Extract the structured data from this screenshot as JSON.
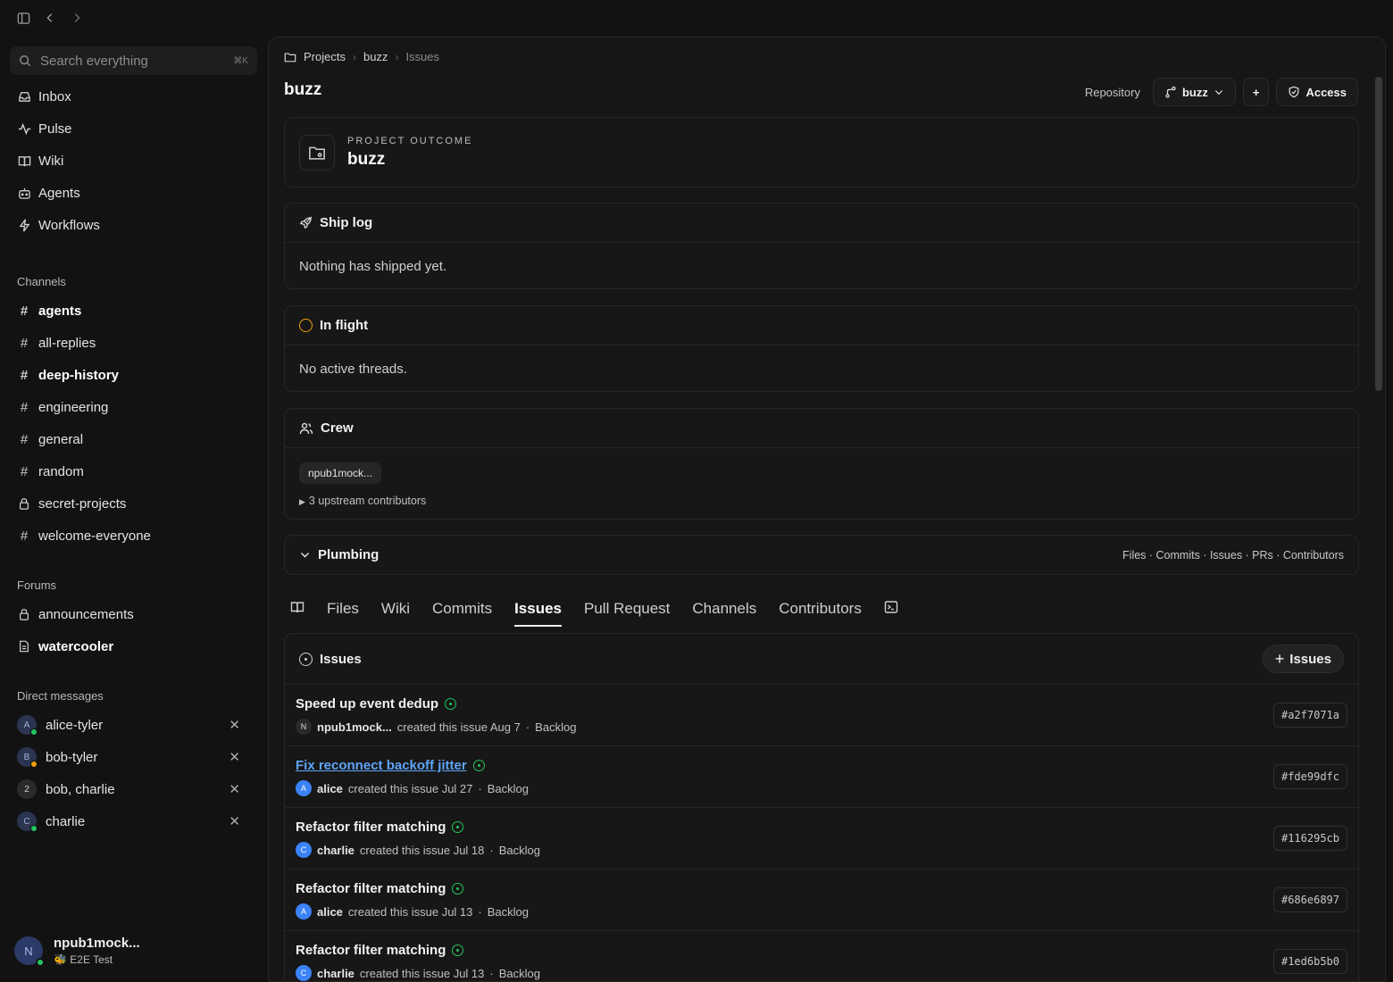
{
  "sidebar": {
    "search_placeholder": "Search everything",
    "search_shortcut": "⌘K",
    "nav": [
      {
        "label": "Inbox",
        "icon": "inbox-icon"
      },
      {
        "label": "Pulse",
        "icon": "pulse-icon"
      },
      {
        "label": "Wiki",
        "icon": "book-icon"
      },
      {
        "label": "Agents",
        "icon": "bot-icon"
      },
      {
        "label": "Workflows",
        "icon": "bolt-icon"
      }
    ],
    "channels_label": "Channels",
    "channels": [
      "agents",
      "all-replies",
      "deep-history",
      "engineering",
      "general",
      "random",
      "secret-projects",
      "welcome-everyone"
    ],
    "forums_label": "Forums",
    "forums": [
      "announcements",
      "watercooler"
    ],
    "dm_label": "Direct messages",
    "dms": [
      {
        "name": "alice-tyler",
        "initial": "A",
        "status_color": "#22c55e"
      },
      {
        "name": "bob-tyler",
        "initial": "B",
        "status_color": "#f59e0b"
      },
      {
        "name": "bob, charlie",
        "initial": "2",
        "status_color": ""
      },
      {
        "name": "charlie",
        "initial": "C",
        "status_color": "#22c55e"
      }
    ],
    "user": {
      "initial": "N",
      "name": "npub1mock...",
      "subtitle": "E2E Test"
    }
  },
  "breadcrumb": [
    "Projects",
    "buzz",
    "Issues"
  ],
  "page_title": "buzz",
  "header": {
    "repository_label": "Repository",
    "branch": "buzz",
    "add": "+",
    "access": "Access"
  },
  "outcome": {
    "kicker": "PROJECT OUTCOME",
    "name": "buzz"
  },
  "ship_log": {
    "title": "Ship log",
    "empty": "Nothing has shipped yet."
  },
  "in_flight": {
    "title": "In flight",
    "empty": "No active threads."
  },
  "crew": {
    "title": "Crew",
    "member": "npub1mock...",
    "upstream": "3 upstream contributors"
  },
  "plumbing": {
    "title": "Plumbing",
    "links": "Files · Commits · Issues · PRs · Contributors"
  },
  "tabs": [
    "Files",
    "Wiki",
    "Commits",
    "Issues",
    "Pull Request",
    "Channels",
    "Contributors"
  ],
  "active_tab": "Issues",
  "issues": {
    "title": "Issues",
    "add_label": "Issues",
    "rows": [
      {
        "title": "Speed up event dedup",
        "author": "npub1mock...",
        "initial": "N",
        "meta": "created this issue Aug 7",
        "state": "Backlog",
        "id": "#a2f7071a",
        "link": false
      },
      {
        "title": "Fix reconnect backoff jitter",
        "author": "alice",
        "initial": "A",
        "meta": "created this issue Jul 27",
        "state": "Backlog",
        "id": "#fde99dfc",
        "link": true
      },
      {
        "title": "Refactor filter matching",
        "author": "charlie",
        "initial": "C",
        "meta": "created this issue Jul 18",
        "state": "Backlog",
        "id": "#116295cb",
        "link": false
      },
      {
        "title": "Refactor filter matching",
        "author": "alice",
        "initial": "A",
        "meta": "created this issue Jul 13",
        "state": "Backlog",
        "id": "#686e6897",
        "link": false
      },
      {
        "title": "Refactor filter matching",
        "author": "charlie",
        "initial": "C",
        "meta": "created this issue Jul 13",
        "state": "Backlog",
        "id": "#1ed6b5b0",
        "link": false
      }
    ]
  }
}
